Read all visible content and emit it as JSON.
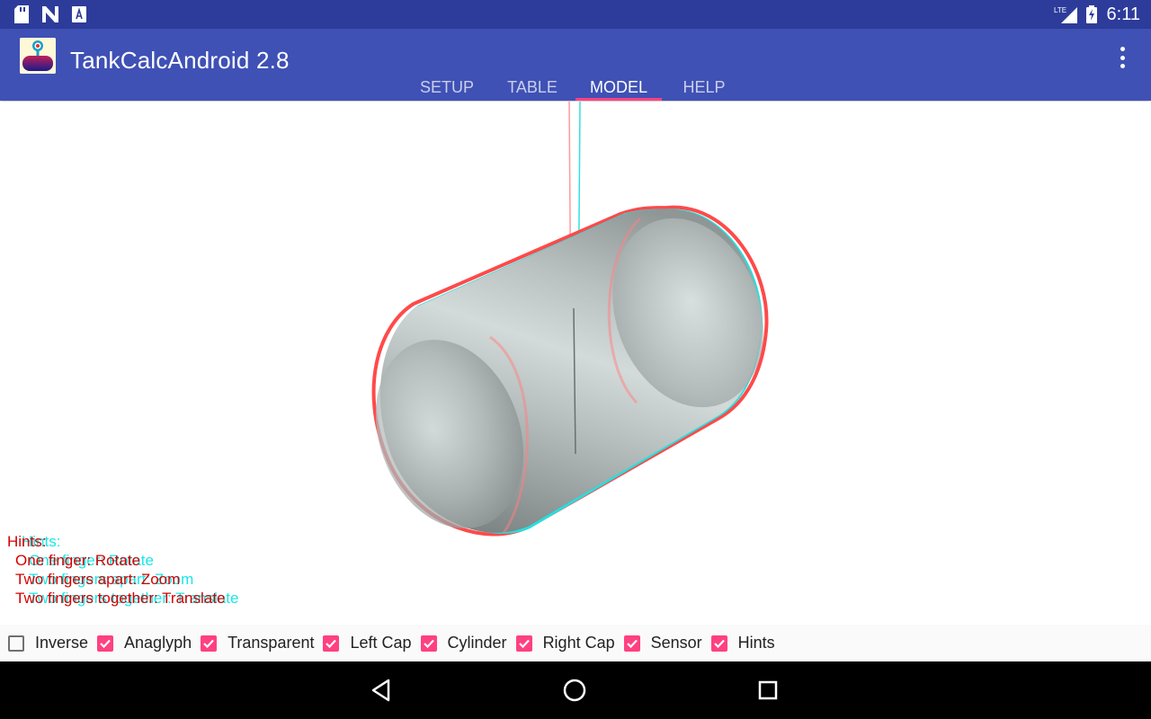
{
  "status_bar": {
    "time": "6:11",
    "network": "LTE",
    "left_icons": [
      "sd-card-icon",
      "n-icon",
      "text-a-icon"
    ]
  },
  "app_bar": {
    "title": "TankCalcAndroid 2.8",
    "tabs": [
      {
        "label": "SETUP",
        "active": false
      },
      {
        "label": "TABLE",
        "active": false
      },
      {
        "label": "MODEL",
        "active": true
      },
      {
        "label": "HELP",
        "active": false
      }
    ]
  },
  "hints": {
    "title": "Hints:",
    "lines": [
      "One finger: Rotate",
      "Two fingers apart: Zoom",
      "Two fingers together: Translate"
    ],
    "colors": {
      "left_eye": "#d40000",
      "right_eye": "#19e6e6"
    }
  },
  "checkboxes": [
    {
      "label": "Inverse",
      "checked": false
    },
    {
      "label": "Anaglyph",
      "checked": true
    },
    {
      "label": "Transparent",
      "checked": true
    },
    {
      "label": "Left Cap",
      "checked": true
    },
    {
      "label": "Cylinder",
      "checked": true
    },
    {
      "label": "Right Cap",
      "checked": true
    },
    {
      "label": "Sensor",
      "checked": true
    },
    {
      "label": "Hints",
      "checked": true
    }
  ],
  "colors": {
    "status_bar": "#2d3c9a",
    "app_bar": "#3f51b5",
    "accent": "#ff4081"
  },
  "nav_bar": [
    "back-icon",
    "home-icon",
    "recents-icon"
  ]
}
